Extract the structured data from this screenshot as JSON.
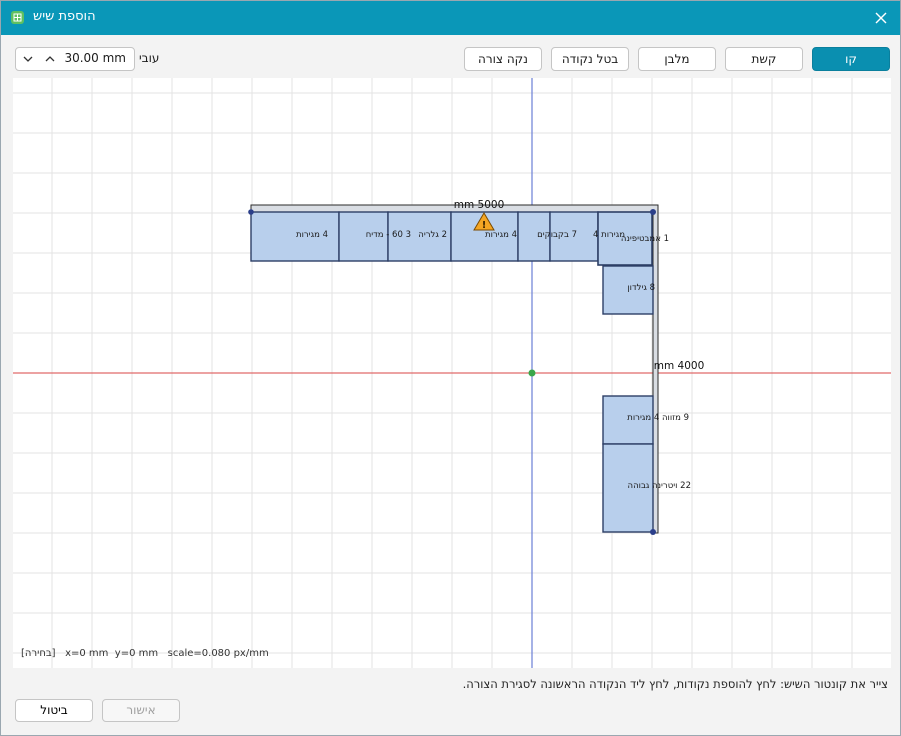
{
  "window": {
    "title": "הוספת שיש"
  },
  "toolbar": {
    "line_label": "קו",
    "arc_label": "קשת",
    "rect_label": "מלבן",
    "undo_point_label": "בטל נקודה",
    "clear_shape_label": "נקה צורה",
    "thickness_label": "עובי",
    "thickness_value": "30.00 mm"
  },
  "canvas": {
    "dims": {
      "top": "mm 5000",
      "right": "mm 4000"
    },
    "cabinets": [
      {
        "label": "4 מגירות"
      },
      {
        "label": "3 60 - מדיח"
      },
      {
        "label": "2 גלריה"
      },
      {
        "label": "4 מגירות"
      },
      {
        "label": "7 בקבוקים"
      },
      {
        "label": "מגירות 4"
      },
      {
        "label": "1 אמבטיפינה"
      },
      {
        "label": "8 גילדון"
      },
      {
        "label": "9 מזווה 4 מגירות"
      },
      {
        "label": "22 ויטרינה גבוהה"
      }
    ],
    "status_mode": "[בחירה]",
    "status_coords": "x=0 mm  y=0 mm   scale=0.080 px/mm"
  },
  "hint": "צייר את קונטור השיש: לחץ להוספת נקודות, לחץ ליד הנקודה הראשונה לסגירת הצורה.",
  "footer": {
    "ok_label": "אישור",
    "cancel_label": "ביטול"
  },
  "colors": {
    "titlebar": "#0a97b8",
    "primary": "#0a8fb0",
    "cabinet_fill": "#b8cfec",
    "cabinet_stroke": "#2d3f66",
    "axis_x": "#e06a6a",
    "axis_y": "#6a7fd6",
    "warning": "#f5a623"
  },
  "icons": {
    "app": "app-icon",
    "close": "close-icon",
    "warning": "warning-icon"
  }
}
